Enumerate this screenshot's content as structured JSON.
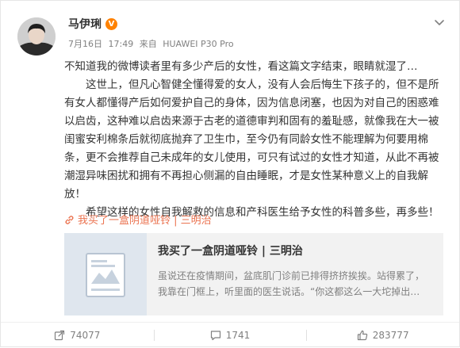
{
  "post": {
    "author": "马伊琍",
    "verified_mark": "V",
    "date": "7月16日",
    "time": "17:49",
    "source_prefix": "来自",
    "device": "HUAWEI P30 Pro",
    "paragraphs": [
      "不知道我的微博读者里有多少产后的女性，看这篇文字结束，眼睛就湿了…",
      "这世上，但凡心智健全懂得爱的女人，没有人会后悔生下孩子的，但不是所有女人都懂得产后如何爱护自己的身体，因为信息闭塞，也因为对自己的困惑难以启齿，这种难以启齿来源于古老的道德审判和固有的羞耻感，就像我在大一被闺蜜安利棉条后就彻底抛弃了卫生巾，至今仍有同龄女性不能理解为何要用棉条，更不会推荐自己未成年的女儿使用，可只有试过的女性才知道，从此不再被潮湿异味困扰和拥有不再担心侧漏的自由睡眠，才是女性某种意义上的自我解放！",
      "希望这样的女性自我解救的信息和产科医生给予女性的科普多些，再多些！"
    ]
  },
  "article_link": {
    "icon": "link-icon",
    "text": "我买了一盒阴道哑铃 | 三明治"
  },
  "card": {
    "title": "我买了一盒阴道哑铃 | 三明治",
    "description": "虽说还在疫情期间，盆底肌门诊前已排得挤挤挨挨。站得累了，我靠在门框上，听里面的医生说话。“你这都这么一大坨掉出…"
  },
  "actions": {
    "share_count": "74077",
    "comment_count": "1741",
    "like_count": "283777"
  },
  "colors": {
    "link": "#eb7350",
    "badge": "#ff8200",
    "text": "#333333",
    "meta": "#808080",
    "card_bg": "#f2f2f2"
  }
}
